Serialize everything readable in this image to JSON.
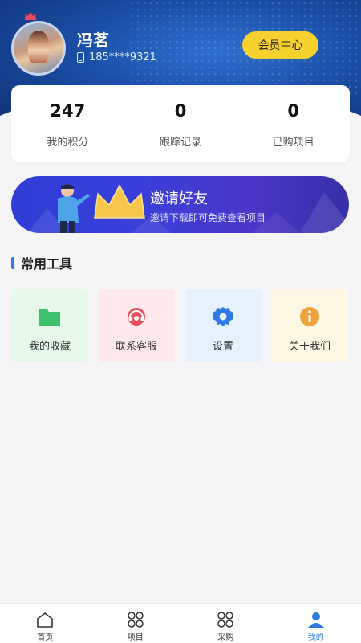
{
  "profile": {
    "name": "冯茗",
    "phone": "185****9321",
    "member_button": "会员中心"
  },
  "stats": [
    {
      "value": "247",
      "label": "我的积分"
    },
    {
      "value": "0",
      "label": "跟踪记录"
    },
    {
      "value": "0",
      "label": "已购项目"
    }
  ],
  "invite": {
    "title": "邀请好友",
    "subtitle": "邀请下载即可免费查看项目"
  },
  "tools_section": {
    "title": "常用工具",
    "items": [
      {
        "label": "我的收藏",
        "icon": "folder-icon",
        "bg": "#e6f8ea",
        "color": "#3cc069"
      },
      {
        "label": "联系客服",
        "icon": "headset-icon",
        "bg": "#fde9ea",
        "color": "#e9505a"
      },
      {
        "label": "设置",
        "icon": "gear-icon",
        "bg": "#e5f2fd",
        "color": "#2f7ae5"
      },
      {
        "label": "关于我们",
        "icon": "info-icon",
        "bg": "#fdf7e3",
        "color": "#f0a23b"
      }
    ]
  },
  "tabbar": {
    "items": [
      {
        "label": "首页",
        "icon": "home-icon"
      },
      {
        "label": "项目",
        "icon": "grid-icon"
      },
      {
        "label": "采购",
        "icon": "grid-icon"
      },
      {
        "label": "我的",
        "icon": "user-icon"
      }
    ],
    "active": "我的"
  },
  "colors": {
    "accent": "#2f7ae5",
    "member_button": "#f7d22e",
    "header": "#1a4fa6"
  }
}
